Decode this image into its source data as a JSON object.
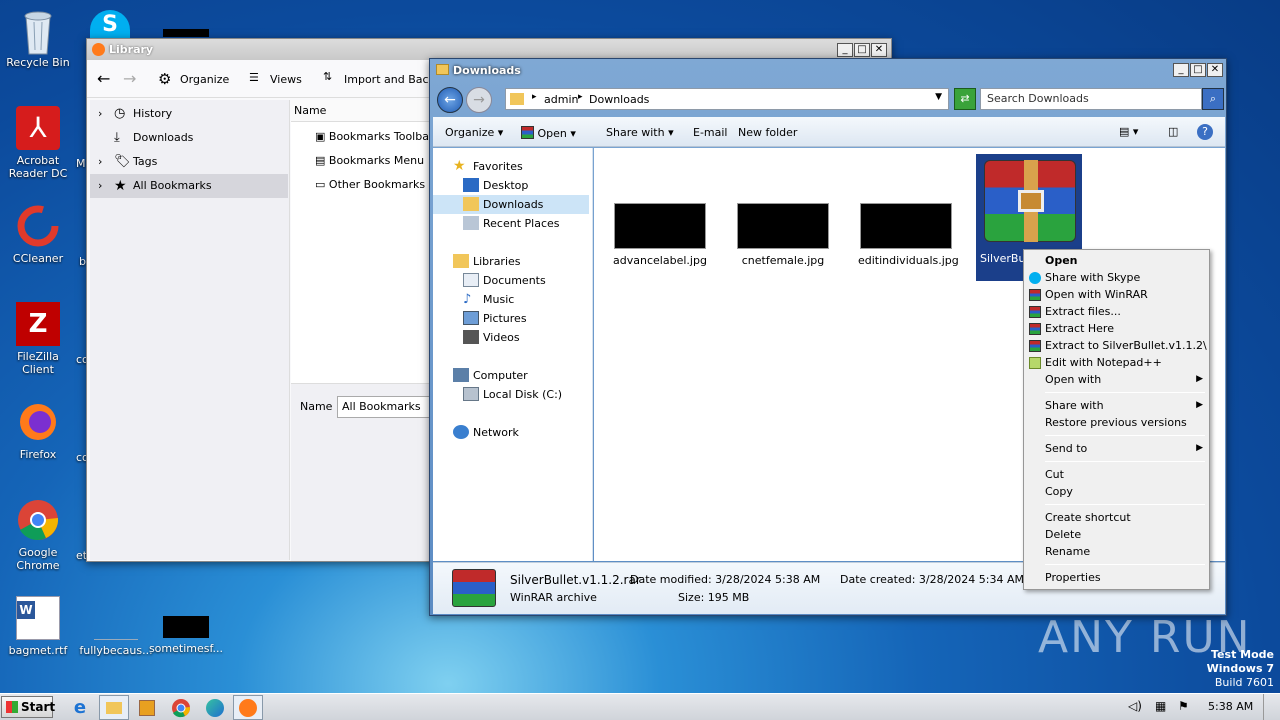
{
  "desktop": {
    "icons": [
      {
        "label": "Recycle Bin"
      },
      {
        "label": "Acrobat Reader DC"
      },
      {
        "label": "CCleaner"
      },
      {
        "label": "FileZilla Client"
      },
      {
        "label": "Firefox"
      },
      {
        "label": "Google Chrome"
      },
      {
        "label": "bagmet.rtf"
      },
      {
        "label": "fullybecaus..."
      },
      {
        "label": "sometimesf..."
      }
    ],
    "partial_labels": [
      "M",
      "b",
      "co",
      "co",
      "et"
    ],
    "watermark": "ANY RUN",
    "test_mode": {
      "line1": "Test Mode",
      "line2": "Windows 7",
      "line3": "Build 7601"
    }
  },
  "library": {
    "title": "Library",
    "toolbar": {
      "organize": "Organize",
      "views": "Views",
      "import": "Import and Backup"
    },
    "tree": [
      "History",
      "Downloads",
      "Tags",
      "All Bookmarks"
    ],
    "column_name": "Name",
    "rows": [
      "Bookmarks Toolbar",
      "Bookmarks Menu",
      "Other Bookmarks"
    ],
    "detail_label": "Name",
    "detail_value": "All Bookmarks"
  },
  "explorer": {
    "title": "Downloads",
    "breadcrumb": [
      "admin",
      "Downloads"
    ],
    "search_placeholder": "Search Downloads",
    "commands": {
      "organize": "Organize",
      "open": "Open",
      "share": "Share with",
      "email": "E-mail",
      "new_folder": "New folder"
    },
    "nav": {
      "favorites": "Favorites",
      "fav_items": [
        "Desktop",
        "Downloads",
        "Recent Places"
      ],
      "libraries": "Libraries",
      "lib_items": [
        "Documents",
        "Music",
        "Pictures",
        "Videos"
      ],
      "computer": "Computer",
      "comp_items": [
        "Local Disk (C:)"
      ],
      "network": "Network"
    },
    "files": [
      {
        "name": "advancelabel.jpg"
      },
      {
        "name": "cnetfemale.jpg"
      },
      {
        "name": "editindividuals.jpg"
      },
      {
        "name": "SilverBull"
      }
    ],
    "status": {
      "filename": "SilverBullet.v1.1.2.rar",
      "type": "WinRAR archive",
      "modified": "Date modified: 3/28/2024 5:38 AM",
      "created": "Date created: 3/28/2024 5:34 AM",
      "size": "Size: 195 MB"
    }
  },
  "context_menu": {
    "items": [
      "Open",
      "Share with Skype",
      "Open with WinRAR",
      "Extract files...",
      "Extract Here",
      "Extract to SilverBullet.v1.1.2\\",
      "Edit with Notepad++",
      "Open with",
      "Share with",
      "Restore previous versions",
      "Send to",
      "Cut",
      "Copy",
      "Create shortcut",
      "Delete",
      "Rename",
      "Properties"
    ]
  },
  "taskbar": {
    "start": "Start",
    "clock": "5:38 AM"
  }
}
